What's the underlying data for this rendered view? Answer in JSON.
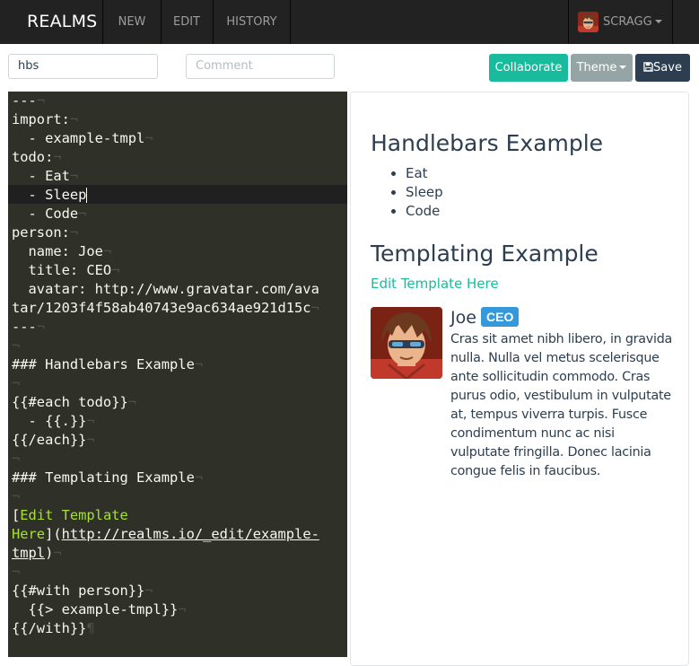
{
  "navbar": {
    "brand": "REALMS",
    "items": [
      {
        "label": "NEW"
      },
      {
        "label": "EDIT"
      },
      {
        "label": "HISTORY"
      }
    ],
    "user": {
      "name": "SCRAGG"
    }
  },
  "toolbar": {
    "page_name_value": "hbs",
    "comment_placeholder": "Comment",
    "collaborate_label": "Collaborate",
    "theme_label": "Theme",
    "save_label": "Save"
  },
  "colors": {
    "navbar_bg": "#222222",
    "collaborate": "#18bc9c",
    "theme": "#95a5a6",
    "save": "#2c3e50",
    "editor_bg": "#2f3129",
    "badge": "#3498db"
  },
  "editor": {
    "lines": [
      "---",
      "import:",
      "  - example-tmpl",
      "todo:",
      "  - Eat",
      "  - Sleep",
      "  - Code",
      "person:",
      "  name: Joe",
      "  title: CEO",
      "  avatar: http://www.gravatar.com/ava",
      "tar/1203f4f58ab40743e9ac634ae921d15c",
      "---",
      "",
      "### Handlebars Example",
      "",
      "{{#each todo}}",
      "  - {{.}}",
      "{{/each}}",
      "",
      "### Templating Example",
      "",
      "[Edit Template",
      "Here](http://realms.io/_edit/example-",
      "tmpl)",
      "",
      "{{#with person}}",
      "  {{> example-tmpl}}",
      "{{/with}}"
    ]
  },
  "preview": {
    "heading1": "Handlebars Example",
    "todo": [
      "Eat",
      "Sleep",
      "Code"
    ],
    "heading2": "Templating Example",
    "edit_link": "Edit Template Here",
    "person": {
      "name": "Joe",
      "title": "CEO",
      "bio": "Cras sit amet nibh libero, in gravida nulla. Nulla vel metus scelerisque ante sollicitudin commodo. Cras purus odio, vestibulum in vulputate at, tempus viverra turpis. Fusce condimentum nunc ac nisi vulputate fringilla. Donec lacinia congue felis in faucibus."
    }
  },
  "icons": {
    "save": "floppy-disk-icon",
    "theme": "caret-down-icon",
    "user": "caret-down-icon"
  }
}
